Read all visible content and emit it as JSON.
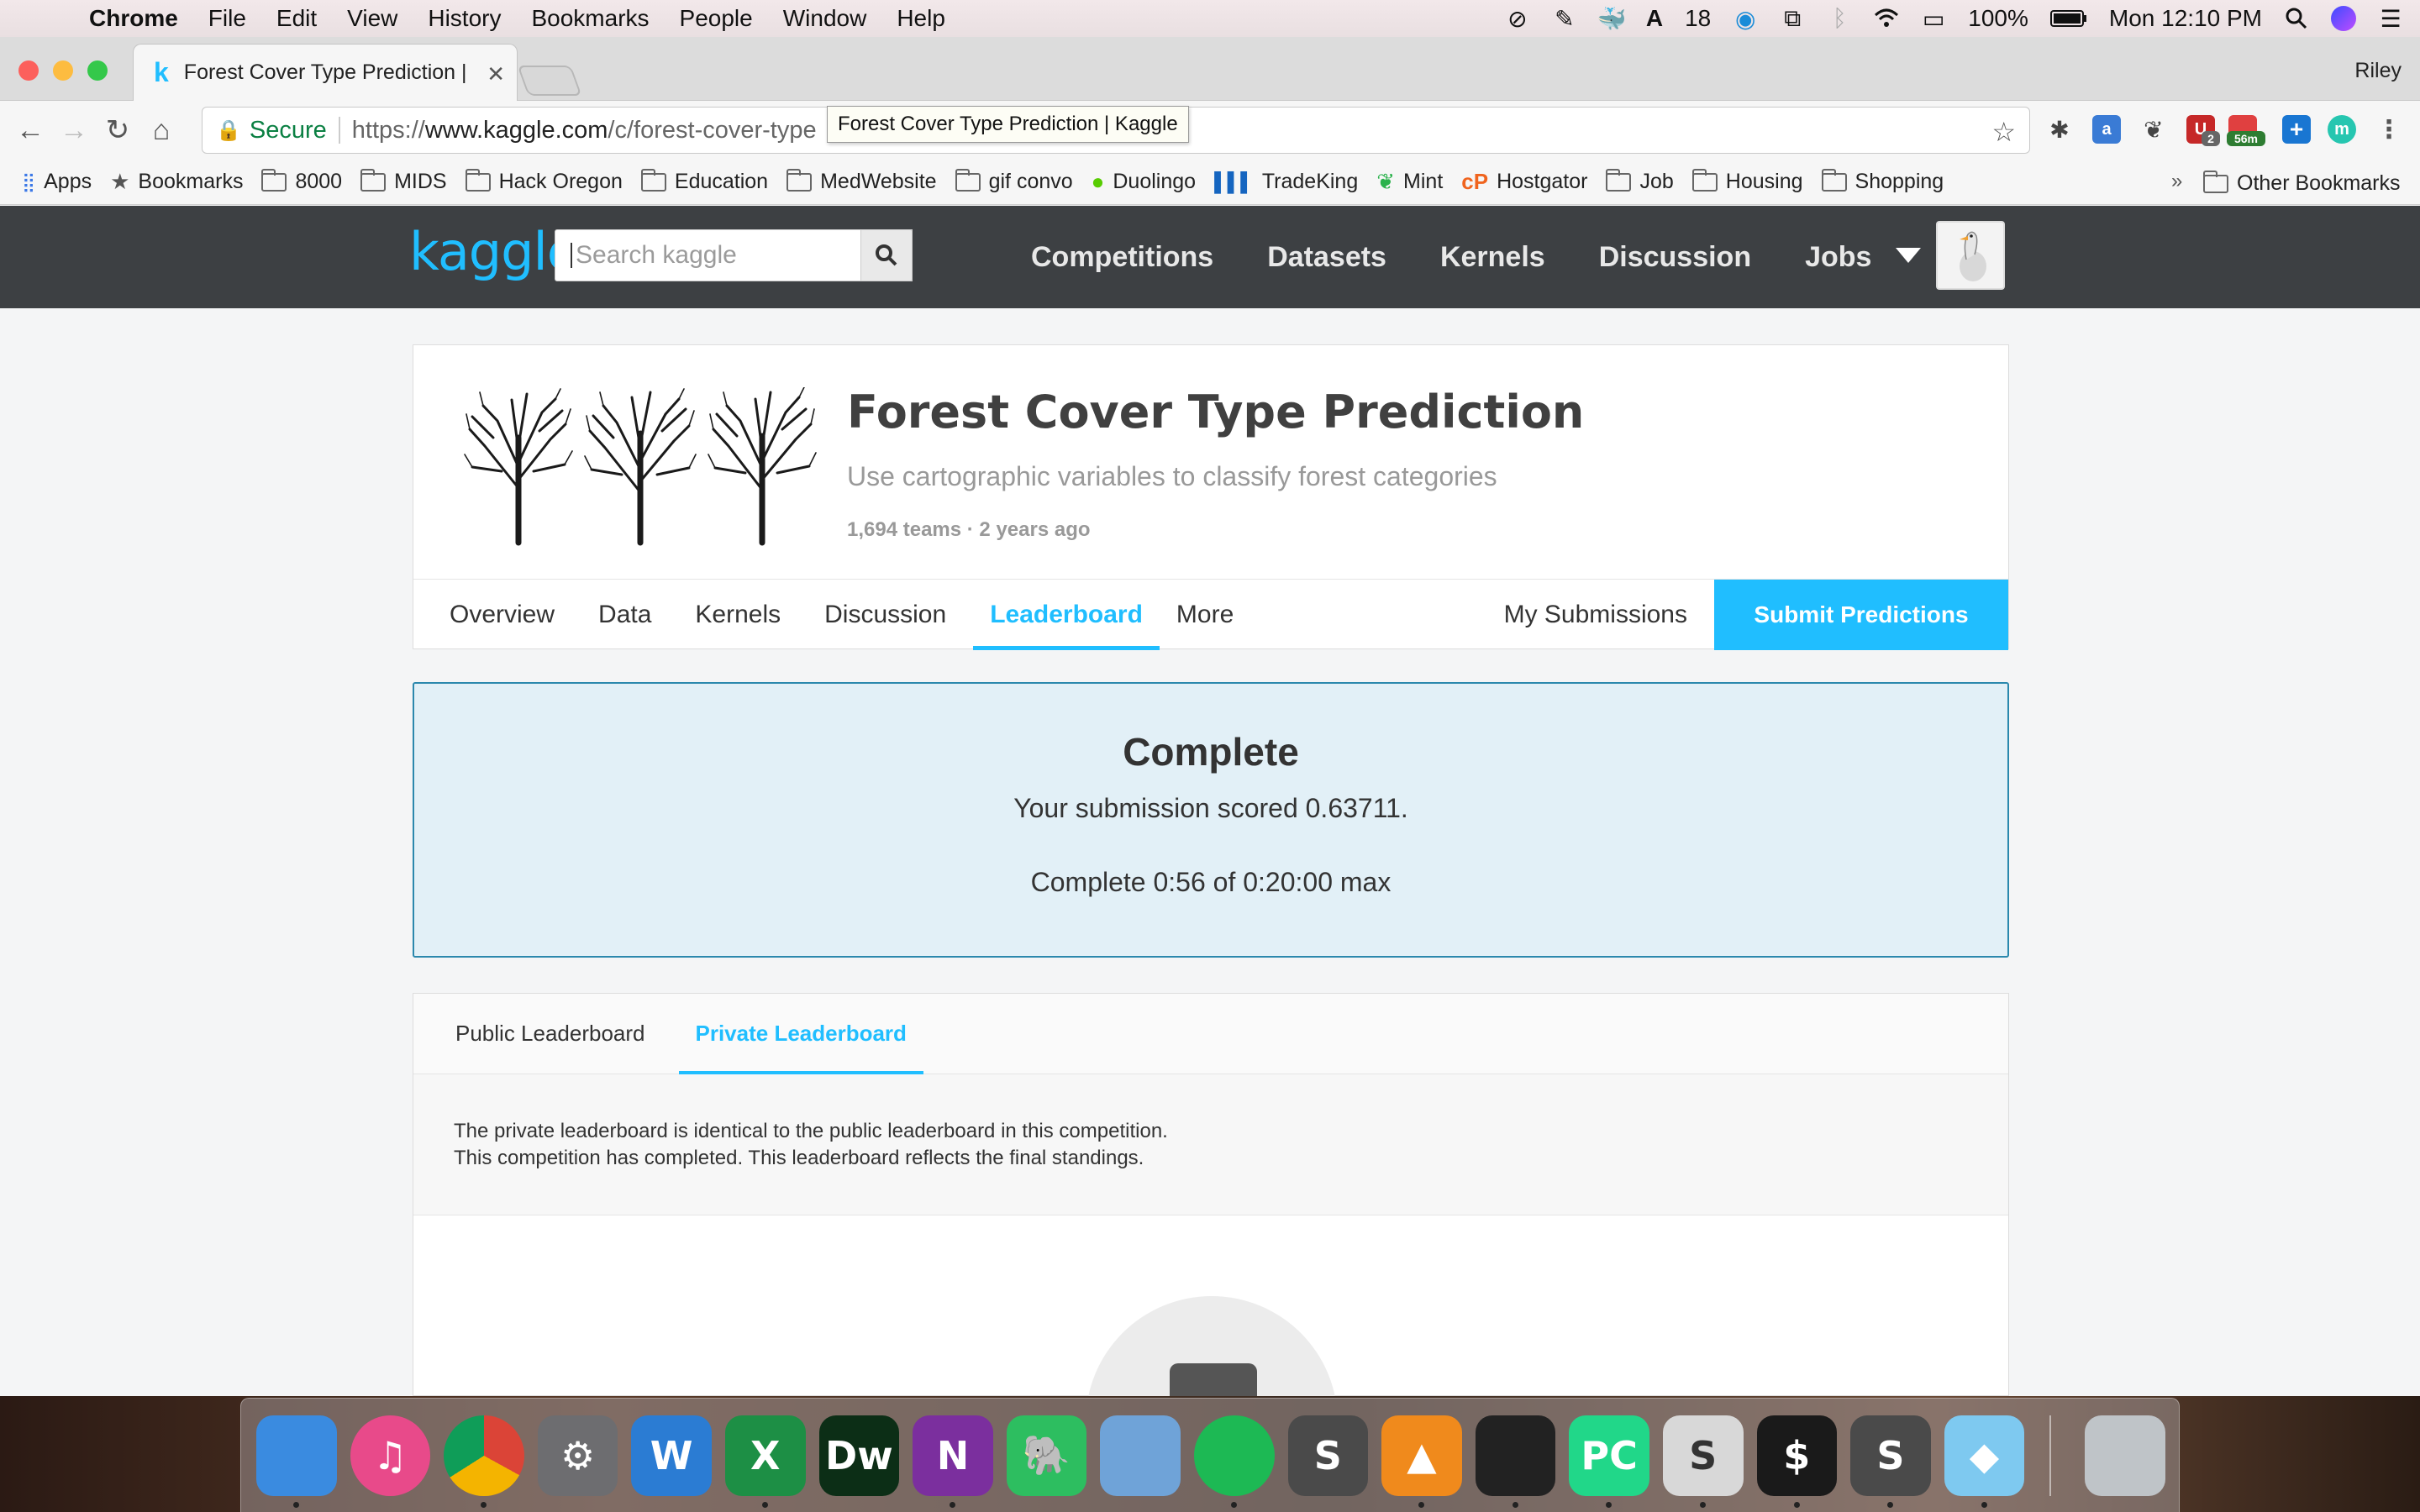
{
  "menubar": {
    "app": "Chrome",
    "items": [
      "File",
      "Edit",
      "View",
      "History",
      "Bookmarks",
      "People",
      "Window",
      "Help"
    ],
    "status_count": "18",
    "battery": "100%",
    "clock": "Mon 12:10 PM"
  },
  "browser": {
    "tab_title": "Forest Cover Type Prediction | Kaggle",
    "tab_title_visible": "Forest Cover Type Prediction |",
    "profile": "Riley",
    "secure_label": "Secure",
    "url_scheme": "https://",
    "url_host": "www.kaggle.com",
    "url_path": "/c/forest-cover-type",
    "tooltip": "Forest Cover Type Prediction | Kaggle",
    "ext_badges": {
      "badge1": "2",
      "badge2": "56m"
    }
  },
  "bookmarks": [
    {
      "label": "Apps",
      "icon": "apps-grid-icon"
    },
    {
      "label": "Bookmarks",
      "icon": "star-icon"
    },
    {
      "label": "8000",
      "icon": "folder-icon"
    },
    {
      "label": "MIDS",
      "icon": "folder-icon"
    },
    {
      "label": "Hack Oregon",
      "icon": "folder-icon"
    },
    {
      "label": "Education",
      "icon": "folder-icon"
    },
    {
      "label": "MedWebsite",
      "icon": "folder-icon"
    },
    {
      "label": "gif convo",
      "icon": "folder-icon"
    },
    {
      "label": "Duolingo",
      "icon": "duolingo-icon"
    },
    {
      "label": "TradeKing",
      "icon": "tradeking-icon"
    },
    {
      "label": "Mint",
      "icon": "mint-icon"
    },
    {
      "label": "Hostgator",
      "icon": "hostgator-icon"
    },
    {
      "label": "Job",
      "icon": "folder-icon"
    },
    {
      "label": "Housing",
      "icon": "folder-icon"
    },
    {
      "label": "Shopping",
      "icon": "folder-icon"
    }
  ],
  "bookmarks_more": "»",
  "other_bookmarks": "Other Bookmarks",
  "kaggle": {
    "logo": "kaggle",
    "search_placeholder": "Search kaggle",
    "nav": [
      "Competitions",
      "Datasets",
      "Kernels",
      "Discussion",
      "Jobs"
    ]
  },
  "competition": {
    "title": "Forest Cover Type Prediction",
    "subtitle": "Use cartographic variables to classify forest categories",
    "meta": "1,694 teams · 2 years ago",
    "tabs": [
      "Overview",
      "Data",
      "Kernels",
      "Discussion",
      "Leaderboard",
      "More"
    ],
    "active_tab": "Leaderboard",
    "my_submissions": "My Submissions",
    "submit": "Submit Predictions"
  },
  "status": {
    "heading": "Complete",
    "score_line": "Your submission scored 0.63711.",
    "time_line": "Complete 0:56 of 0:20:00 max"
  },
  "leaderboard": {
    "tabs": [
      "Public Leaderboard",
      "Private Leaderboard"
    ],
    "active_tab": "Private Leaderboard",
    "note_line1": "The private leaderboard is identical to the public leaderboard in this competition.",
    "note_line2": "This competition has completed. This leaderboard reflects the final standings."
  },
  "dock": [
    {
      "name": "finder",
      "label": "",
      "color": "#3a8be0"
    },
    {
      "name": "itunes",
      "label": "♫",
      "color": "#e84a8a"
    },
    {
      "name": "chrome",
      "label": "",
      "color": "#e8e8e8"
    },
    {
      "name": "system-preferences",
      "label": "⚙",
      "color": "#6d6d70"
    },
    {
      "name": "word",
      "label": "W",
      "color": "#2b7cd3"
    },
    {
      "name": "excel",
      "label": "X",
      "color": "#1d8f45"
    },
    {
      "name": "dreamweaver",
      "label": "Dw",
      "color": "#0c2e16"
    },
    {
      "name": "onenote",
      "label": "N",
      "color": "#7b2f9e"
    },
    {
      "name": "evernote",
      "label": "🐘",
      "color": "#2dbe60"
    },
    {
      "name": "preview",
      "label": "",
      "color": "#6fa3d8"
    },
    {
      "name": "spotify",
      "label": "",
      "color": "#1db954"
    },
    {
      "name": "sublime-text",
      "label": "S",
      "color": "#4a4a4a"
    },
    {
      "name": "vlc",
      "label": "▲",
      "color": "#f08a1c"
    },
    {
      "name": "activity-monitor",
      "label": "",
      "color": "#222"
    },
    {
      "name": "pycharm",
      "label": "PC",
      "color": "#21d789"
    },
    {
      "name": "slack",
      "label": "S",
      "color": "#d8d8d8"
    },
    {
      "name": "terminal",
      "label": "$",
      "color": "#1a1a1a"
    },
    {
      "name": "sublime-text-2",
      "label": "S",
      "color": "#4a4a4a"
    },
    {
      "name": "sketch",
      "label": "◆",
      "color": "#7ec9f0"
    },
    {
      "name": "trash",
      "label": "",
      "color": "#bfc4c8"
    }
  ],
  "colors": {
    "accent": "#20beff",
    "header_bg": "#3d4043",
    "status_bg": "#e2f0f7",
    "status_border": "#2b88ad"
  }
}
